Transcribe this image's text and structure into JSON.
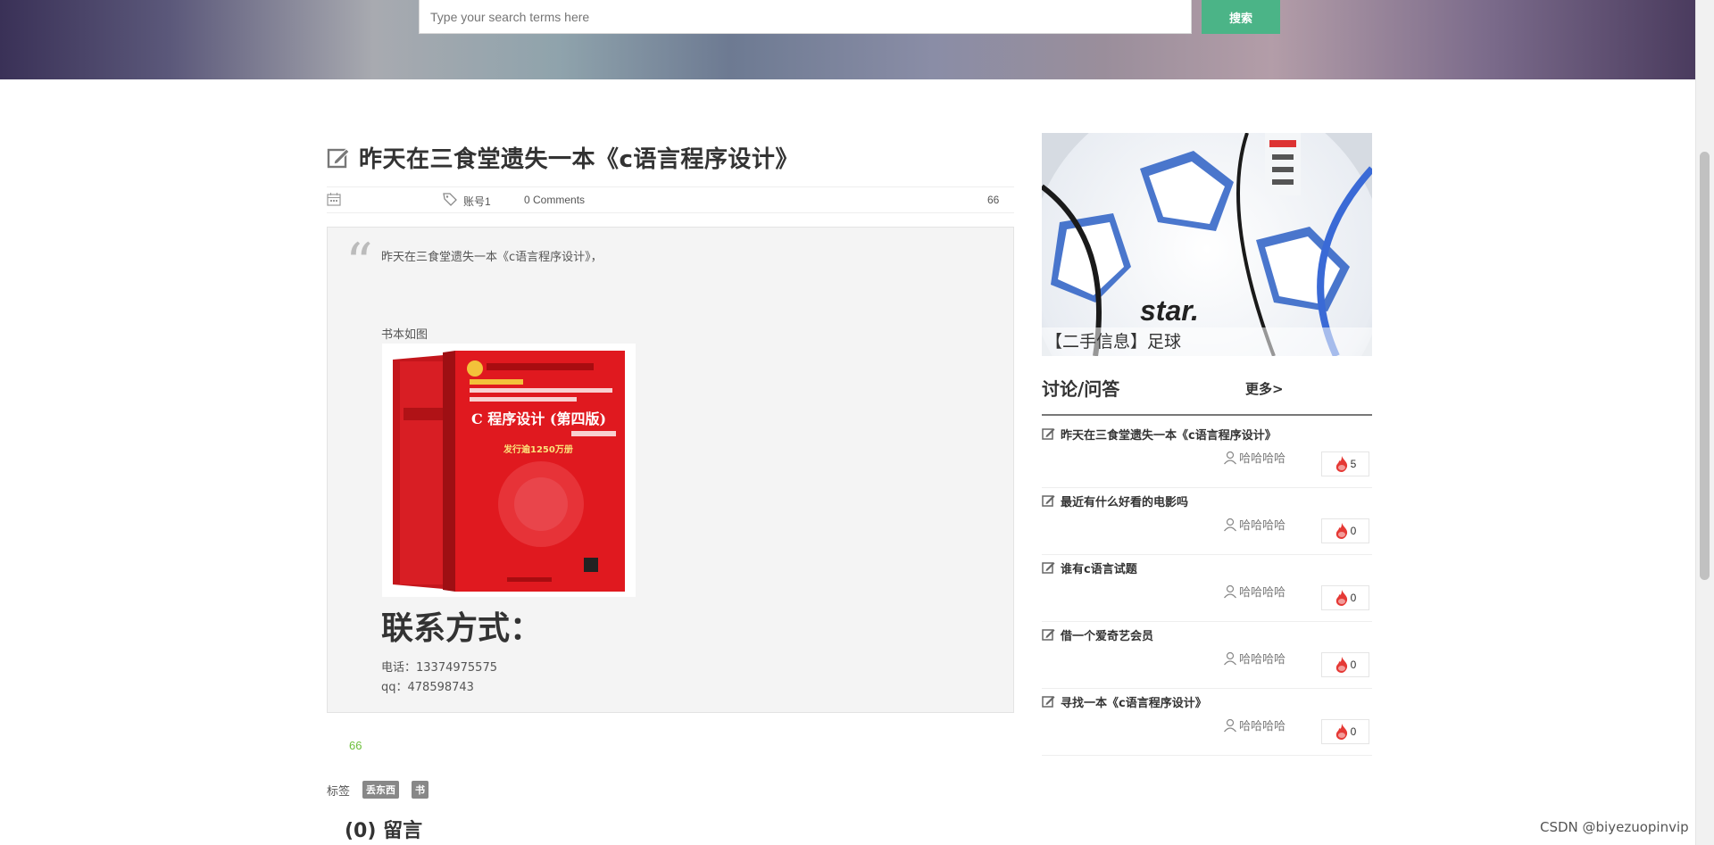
{
  "search": {
    "placeholder": "Type your search terms here",
    "button_label": "搜索"
  },
  "post": {
    "title": "昨天在三食堂遗失一本《c语言程序设计》",
    "meta": {
      "author": "账号1",
      "comments": "0 Comments",
      "views": "66"
    },
    "intro": "昨天在三食堂遗失一本《c语言程序设计》，",
    "image_caption": "书本如图",
    "contact_heading": "联系方式：",
    "phone": "电话：13374975575",
    "qq": "qq：478598743",
    "views_count": "66",
    "tags_label": "标签",
    "tags": [
      "丢东西",
      "书"
    ],
    "comments_heading": "(0) 留言"
  },
  "sidebar": {
    "banner_caption": "【二手信息】足球",
    "qa_title": "讨论/问答",
    "qa_more": "更多>",
    "items": [
      {
        "title": "昨天在三食堂遗失一本《c语言程序设计》",
        "user": "哈哈哈哈",
        "hot": "5"
      },
      {
        "title": "最近有什么好看的电影吗",
        "user": "哈哈哈哈",
        "hot": "0"
      },
      {
        "title": "谁有c语言试题",
        "user": "哈哈哈哈",
        "hot": "0"
      },
      {
        "title": "借一个爱奇艺会员",
        "user": "哈哈哈哈",
        "hot": "0"
      },
      {
        "title": "寻找一本《c语言程序设计》",
        "user": "哈哈哈哈",
        "hot": "0"
      }
    ]
  },
  "watermark": "CSDN @biyezuopinvip",
  "colors": {
    "accent_green": "#4bb487",
    "views_green": "#6cbf3a",
    "hot_red": "#e53935"
  }
}
